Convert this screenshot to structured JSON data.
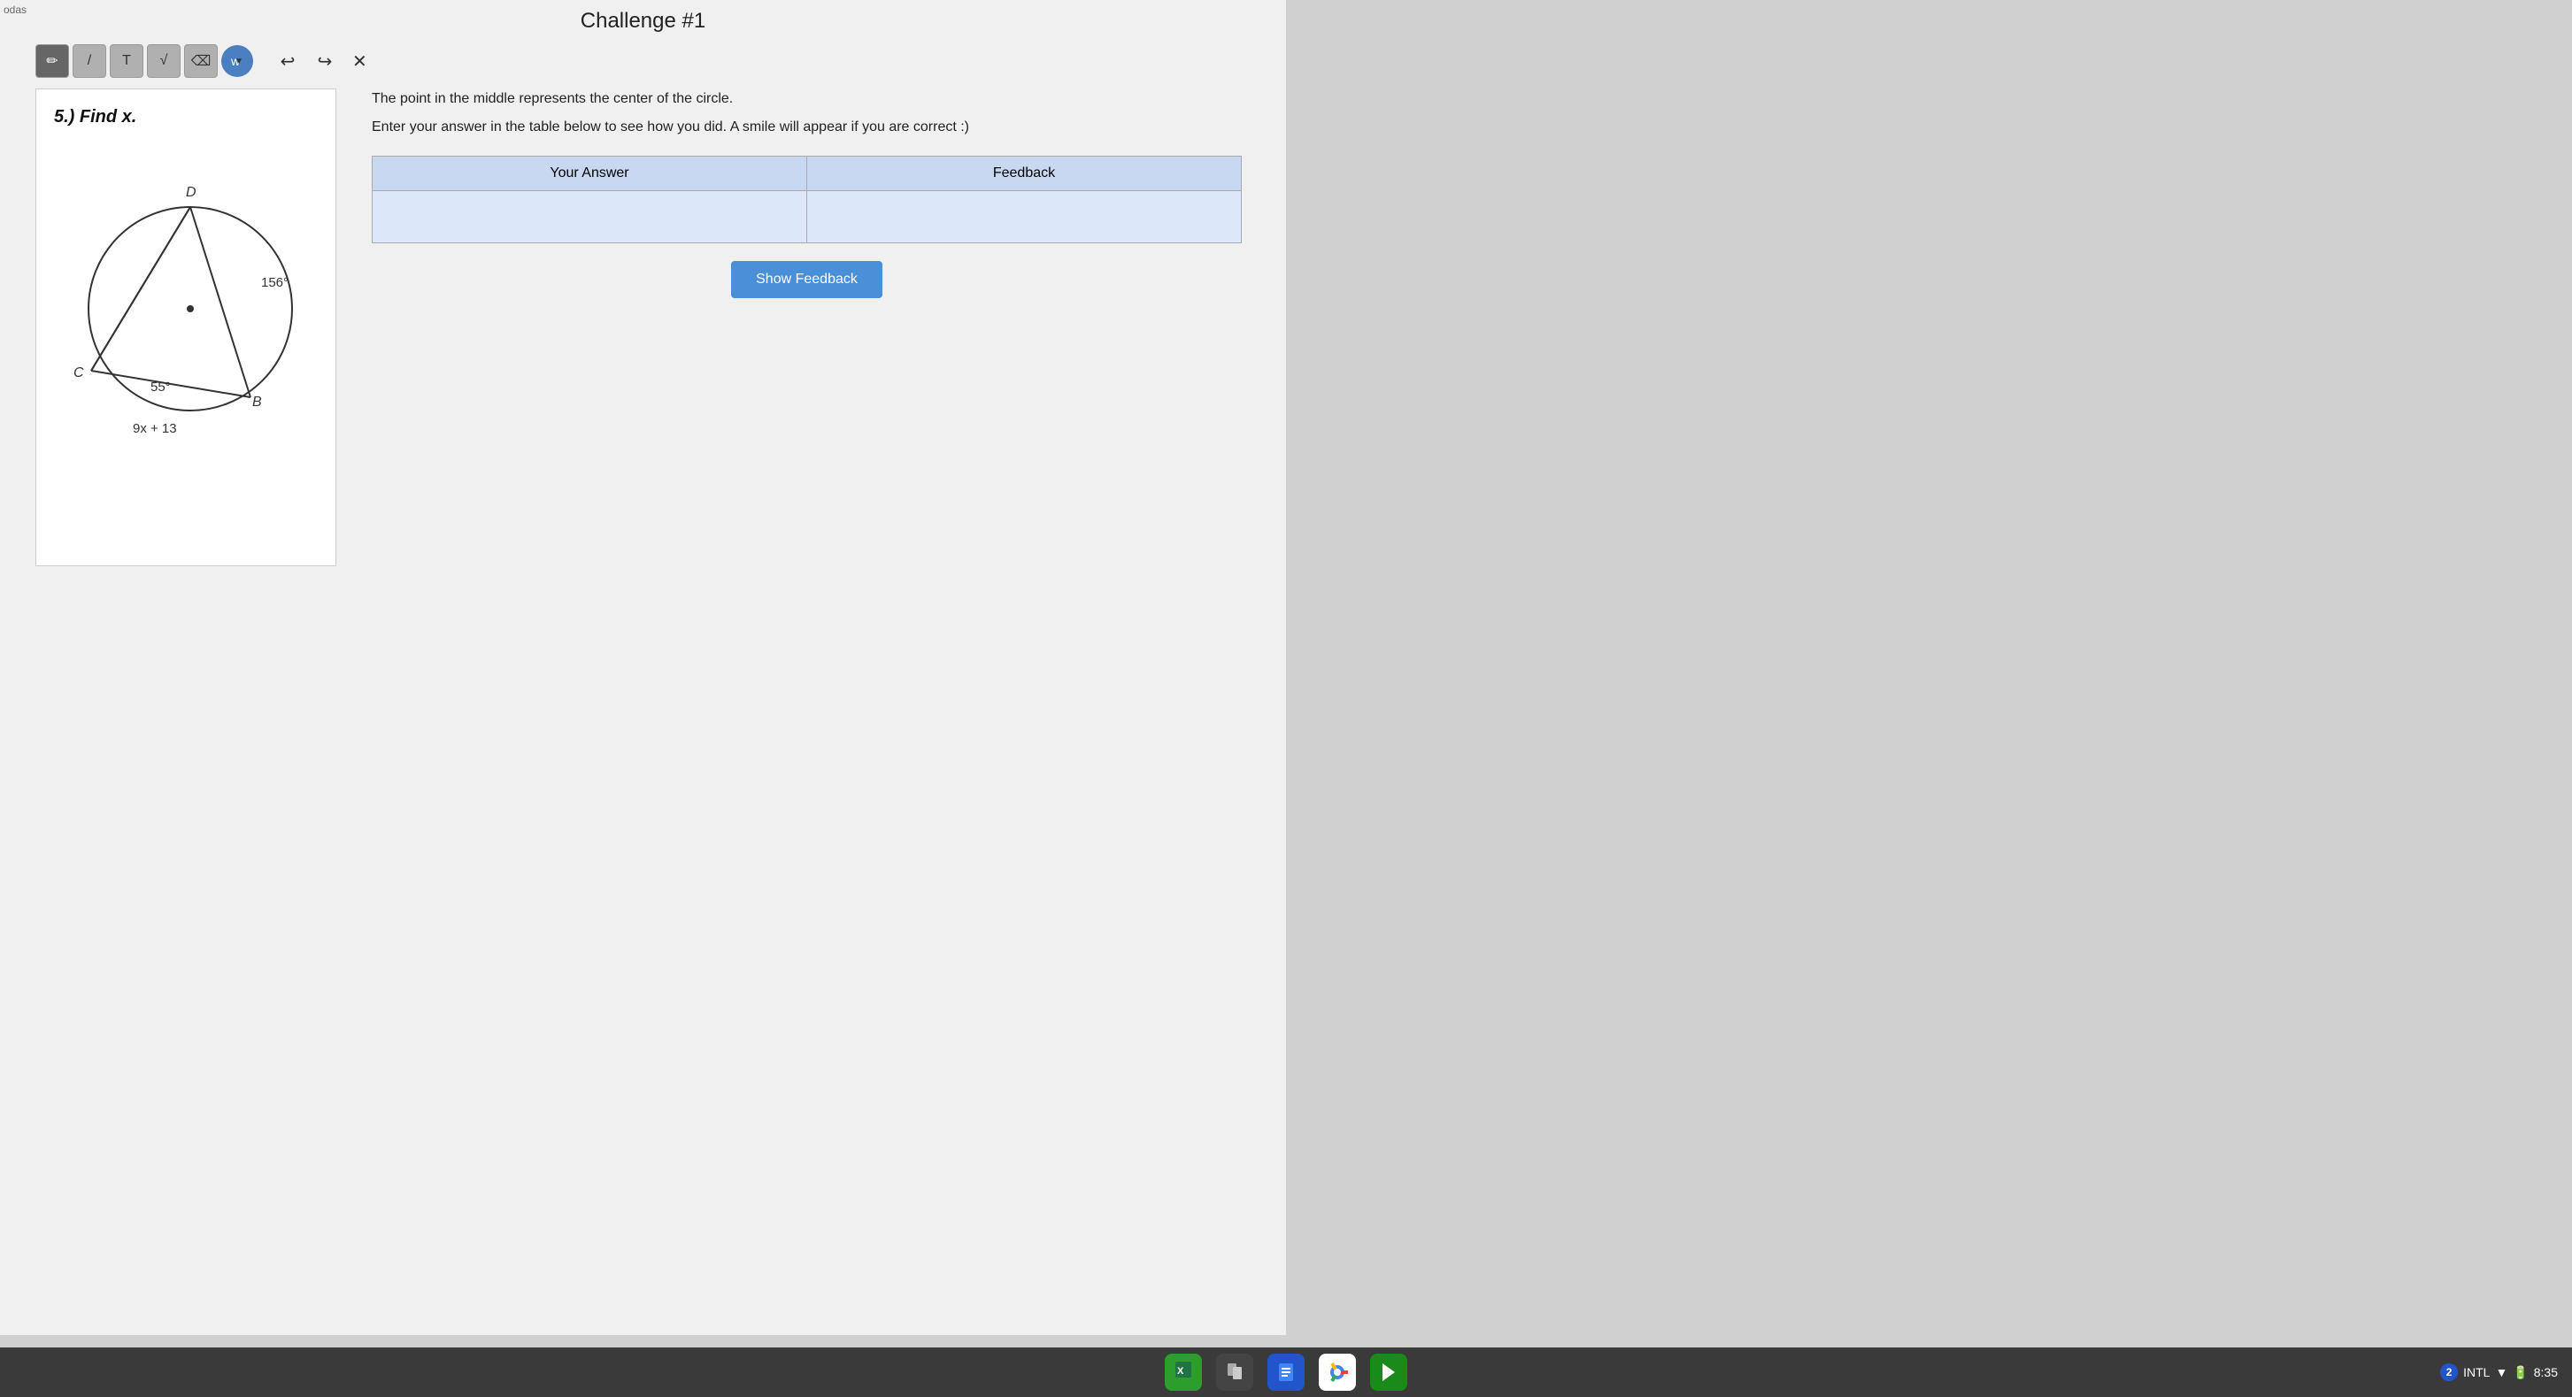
{
  "app": {
    "name": "odas",
    "title": "Challenge #1"
  },
  "toolbar": {
    "buttons": [
      {
        "id": "pencil",
        "label": "✏",
        "active": true
      },
      {
        "id": "line",
        "label": "/"
      },
      {
        "id": "text",
        "label": "T"
      },
      {
        "id": "sqrt",
        "label": "√"
      },
      {
        "id": "eraser",
        "label": "⌫"
      },
      {
        "id": "color",
        "label": "w",
        "active_blue": true
      }
    ],
    "undo_label": "↩",
    "redo_label": "↪",
    "close_label": "✕"
  },
  "problem": {
    "label": "5.) Find x.",
    "angle1": "156°",
    "angle2": "55°",
    "expression": "9x + 13",
    "vertex_d": "D",
    "vertex_c": "C",
    "vertex_b": "B"
  },
  "description": {
    "line1": "The point in the middle represents the center of the circle.",
    "line2": "Enter your answer in the table below to see how you did. A smile will appear if you are correct :)"
  },
  "table": {
    "col1_header": "Your Answer",
    "col2_header": "Feedback",
    "answer_value": "",
    "feedback_value": ""
  },
  "buttons": {
    "show_feedback": "Show Feedback"
  },
  "taskbar": {
    "icons": [
      {
        "id": "excel",
        "symbol": "📊",
        "color": "green"
      },
      {
        "id": "files",
        "symbol": "📁",
        "color": "dark"
      },
      {
        "id": "docs",
        "symbol": "📝",
        "color": "blue"
      },
      {
        "id": "chrome",
        "symbol": "🌐",
        "color": "chrome"
      },
      {
        "id": "play",
        "symbol": "▶",
        "color": "play"
      }
    ],
    "status": {
      "badge_count": "2",
      "intl_label": "INTL",
      "time": "8:35"
    }
  },
  "colors": {
    "toolbar_active": "#666666",
    "blue_button": "#4a7fc1",
    "feedback_button": "#4a90d9",
    "table_header_bg": "#c8d8f0",
    "table_cell_bg": "#dce8fa"
  }
}
